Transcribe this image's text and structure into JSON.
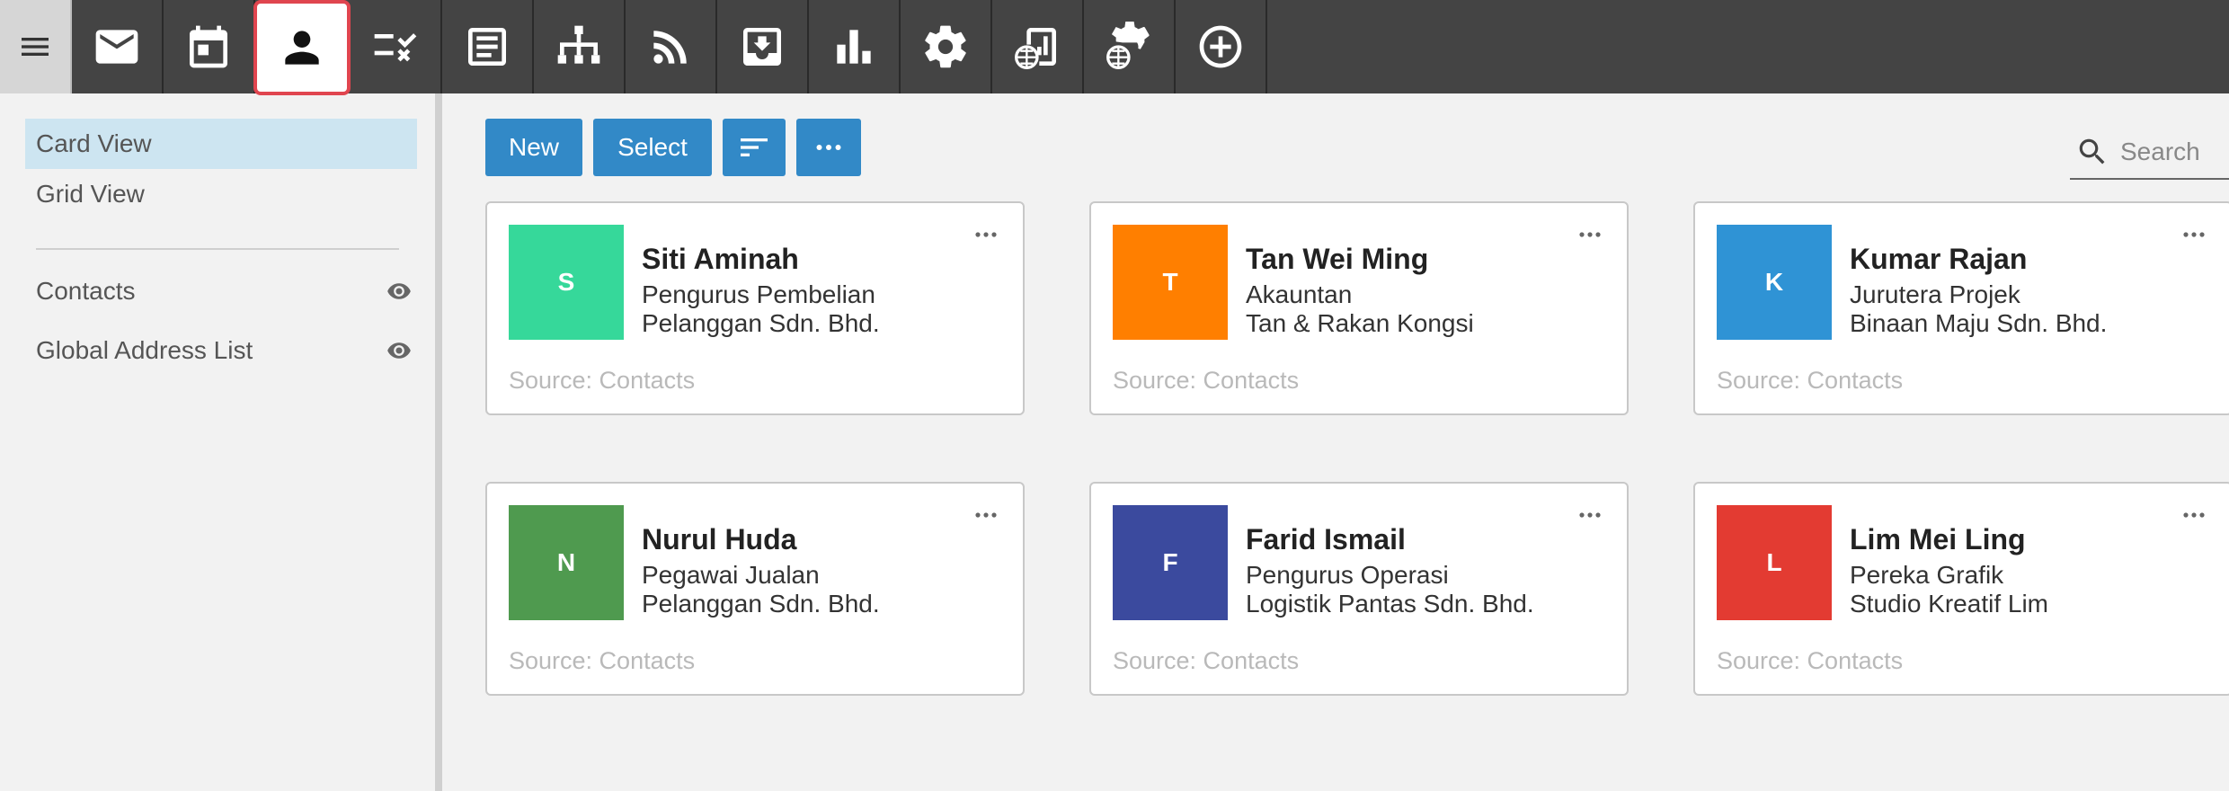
{
  "topbar": {
    "items": [
      {
        "icon": "menu-icon"
      },
      {
        "icon": "mail-icon"
      },
      {
        "icon": "calendar-icon"
      },
      {
        "icon": "contacts-icon",
        "active": true
      },
      {
        "icon": "tasks-icon"
      },
      {
        "icon": "notes-icon"
      },
      {
        "icon": "org-chart-icon"
      },
      {
        "icon": "rss-icon"
      },
      {
        "icon": "inbox-download-icon"
      },
      {
        "icon": "bar-chart-icon"
      },
      {
        "icon": "settings-icon"
      },
      {
        "icon": "global-report-icon"
      },
      {
        "icon": "global-settings-icon"
      },
      {
        "icon": "add-circle-icon"
      }
    ]
  },
  "sidebar": {
    "views": [
      {
        "label": "Card View",
        "selected": true
      },
      {
        "label": "Grid View",
        "selected": false
      }
    ],
    "sources": [
      {
        "label": "Contacts",
        "icon": "eye-icon"
      },
      {
        "label": "Global Address List",
        "icon": "eye-icon"
      }
    ]
  },
  "toolbar": {
    "new_label": "New",
    "select_label": "Select",
    "sort_icon": "sort-icon",
    "more_icon": "more-horizontal-icon",
    "accent": "#3289c7"
  },
  "search": {
    "placeholder": "Search"
  },
  "cards": [
    {
      "initial": "S",
      "color": "#36d89a",
      "name": "Siti Aminah",
      "title": "Pengurus Pembelian",
      "company": "Pelanggan Sdn. Bhd.",
      "source": "Source: Contacts"
    },
    {
      "initial": "T",
      "color": "#ff7f00",
      "name": "Tan Wei Ming",
      "title": "Akauntan",
      "company": "Tan & Rakan Kongsi",
      "source": "Source: Contacts"
    },
    {
      "initial": "K",
      "color": "#2f93d5",
      "name": "Kumar Rajan",
      "title": "Jurutera Projek",
      "company": "Binaan Maju Sdn. Bhd.",
      "source": "Source: Contacts"
    },
    {
      "initial": "N",
      "color": "#4f9a4f",
      "name": "Nurul Huda",
      "title": "Pegawai Jualan",
      "company": "Pelanggan Sdn. Bhd.",
      "source": "Source: Contacts"
    },
    {
      "initial": "F",
      "color": "#3b4a9e",
      "name": "Farid Ismail",
      "title": "Pengurus Operasi",
      "company": "Logistik Pantas Sdn. Bhd.",
      "source": "Source: Contacts"
    },
    {
      "initial": "L",
      "color": "#e33b32",
      "name": "Lim Mei Ling",
      "title": "Pereka Grafik",
      "company": "Studio Kreatif Lim",
      "source": "Source: Contacts"
    }
  ]
}
